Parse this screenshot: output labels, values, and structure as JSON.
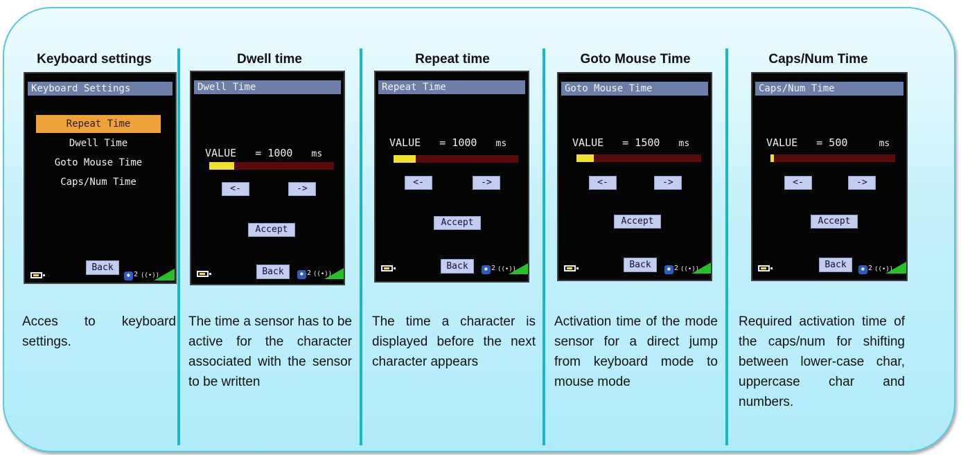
{
  "columns": [
    {
      "heading": "Keyboard settings",
      "description": "Acces to keyboard settings.",
      "screen": {
        "title": "Keyboard Settings",
        "menu_items": [
          "Repeat Time",
          "Dwell Time",
          "Goto Mouse Time",
          "Caps/Num Time"
        ],
        "selected_item": "Repeat Time",
        "back_label": "Back",
        "bt_number": "2"
      }
    },
    {
      "heading": "Dwell time",
      "description": "The time a sensor has to be active for the character associated with the sensor to be written",
      "screen": {
        "title": "Dwell Time",
        "value_label": "VALUE",
        "value_text": "= 1000",
        "unit": "ms",
        "slider_fraction": 0.2,
        "prev_label": "<-",
        "next_label": "->",
        "accept_label": "Accept",
        "back_label": "Back",
        "bt_number": "2"
      }
    },
    {
      "heading": "Repeat time",
      "description": "The time a character is displayed before the next character appears",
      "screen": {
        "title": "Repeat Time",
        "value_label": "VALUE",
        "value_text": "= 1000",
        "unit": "ms",
        "slider_fraction": 0.18,
        "prev_label": "<-",
        "next_label": "->",
        "accept_label": "Accept",
        "back_label": "Back",
        "bt_number": "2"
      }
    },
    {
      "heading": "Goto Mouse Time",
      "description": "Activation time of the mode sensor for a direct jump from keyboard mode to mouse mode",
      "screen": {
        "title": "Goto Mouse Time",
        "value_label": "VALUE",
        "value_text": "= 1500",
        "unit": "ms",
        "slider_fraction": 0.14,
        "prev_label": "<-",
        "next_label": "->",
        "accept_label": "Accept",
        "back_label": "Back",
        "bt_number": "2"
      }
    },
    {
      "heading": "Caps/Num Time",
      "description": "Required activation time of the caps/num for shifting between lower-case char, uppercase char and numbers.",
      "screen": {
        "title": "Caps/Num Time",
        "value_label": "VALUE",
        "value_text": "= 500",
        "unit": "ms",
        "slider_fraction": 0.03,
        "prev_label": "<-",
        "next_label": "->",
        "accept_label": "Accept",
        "back_label": "Back",
        "bt_number": "2"
      }
    }
  ],
  "colors": {
    "panel_border": "#5cc7dc",
    "divider": "#17b8c8",
    "menu_selected": "#f0a23a",
    "slider_fill": "#f0e030",
    "slider_track": "#5a0a0a",
    "button_bg": "#c2cdf0",
    "title_bar": "#6b7fa8"
  },
  "icons": [
    "battery-icon",
    "bluetooth-icon",
    "wireless-icon",
    "signal-strength-icon"
  ]
}
